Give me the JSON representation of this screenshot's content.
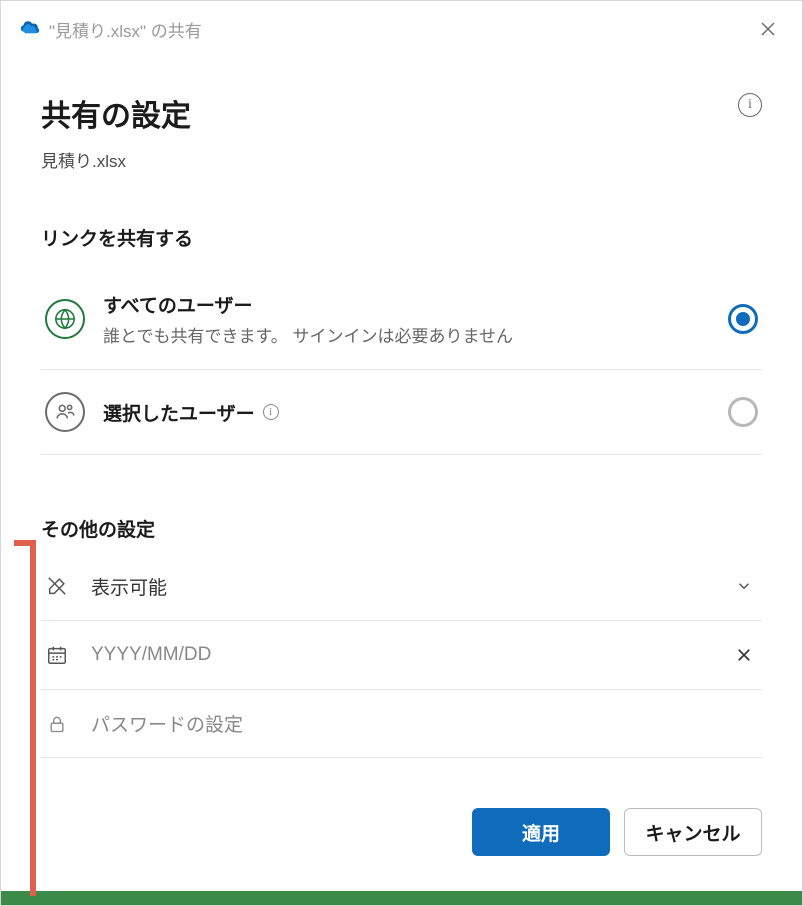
{
  "titlebar": {
    "text": "\"見積り.xlsx\" の共有"
  },
  "header": {
    "title": "共有の設定",
    "filename": "見積り.xlsx"
  },
  "sections": {
    "link_share": "リンクを共有する",
    "more_settings": "その他の設定"
  },
  "options": {
    "everyone": {
      "title": "すべてのユーザー",
      "desc": "誰とでも共有できます。 サインインは必要ありません"
    },
    "selected": {
      "title": "選択したユーザー"
    }
  },
  "settings": {
    "permission": {
      "value": "表示可能"
    },
    "date": {
      "placeholder": "YYYY/MM/DD"
    },
    "password": {
      "placeholder": "パスワードの設定"
    }
  },
  "footer": {
    "apply": "適用",
    "cancel": "キャンセル"
  }
}
